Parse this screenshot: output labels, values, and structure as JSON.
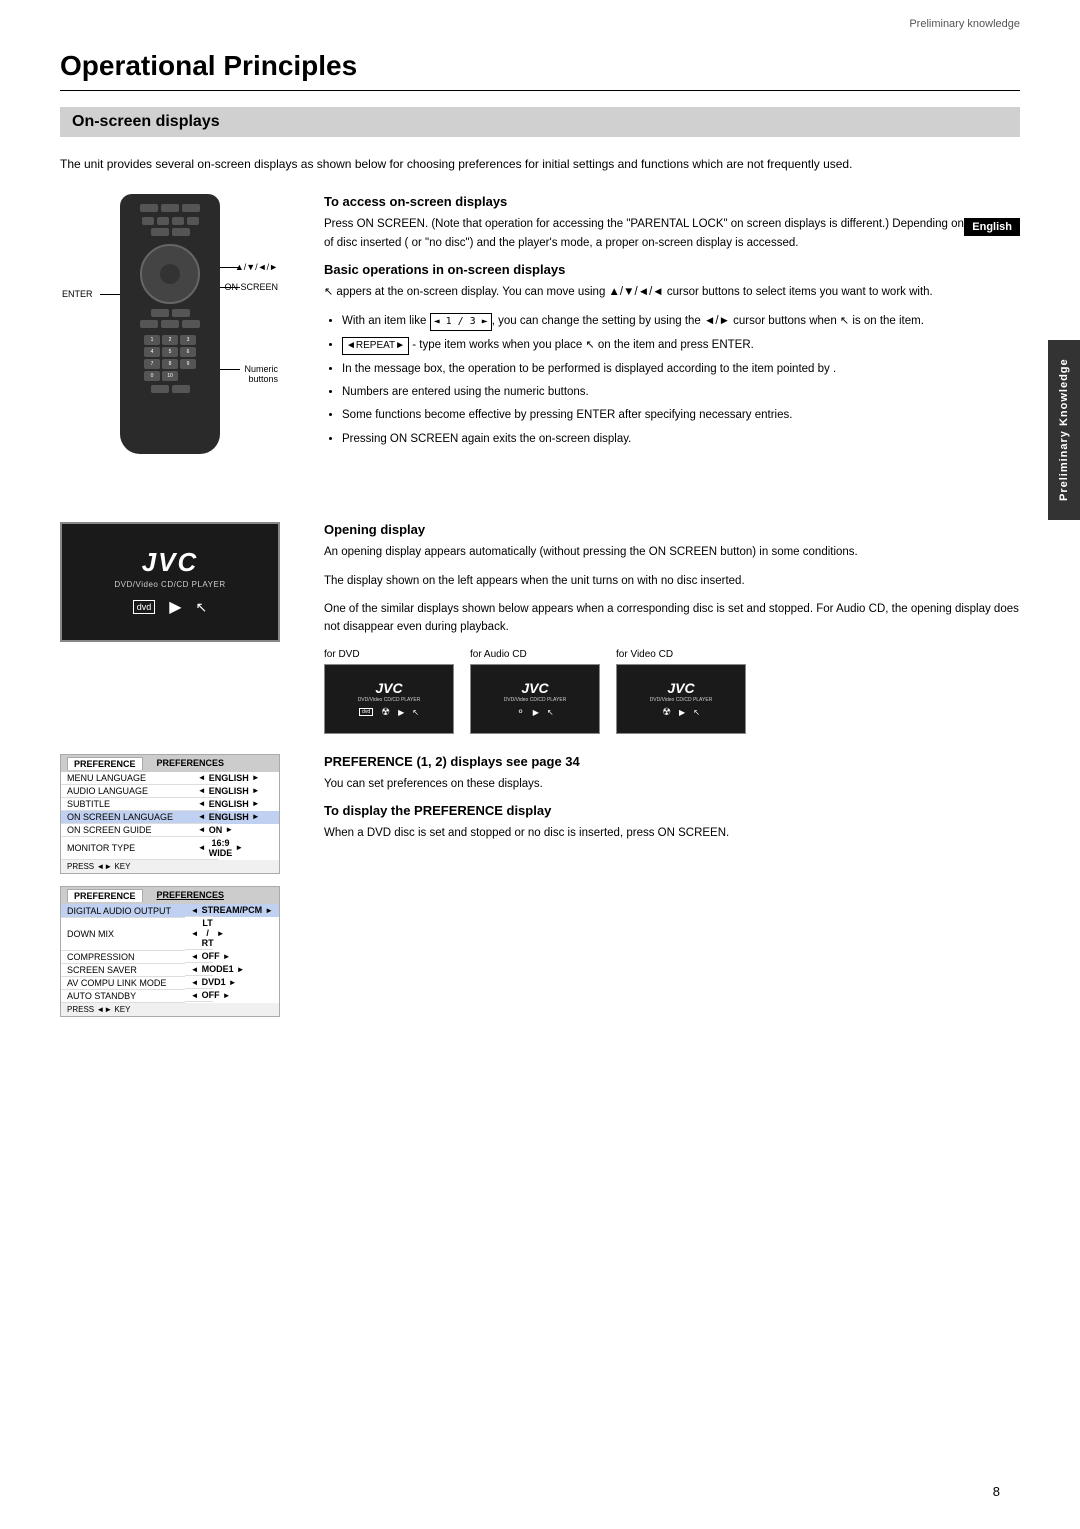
{
  "page": {
    "preliminary_knowledge": "Preliminary knowledge",
    "page_number": "8",
    "english_badge": "English",
    "side_tab": "Preliminary Knowledge"
  },
  "chapter": {
    "title": "Operational Principles"
  },
  "section": {
    "title": "On-screen displays"
  },
  "intro": {
    "text": "The unit provides several on-screen displays as shown below for choosing preferences for initial settings and functions which are not frequently used."
  },
  "access_section": {
    "heading": "To access on-screen displays",
    "body": "Press ON SCREEN. (Note that operation for accessing the \"PARENTAL LOCK\" on screen displays is different.) Depending on the type of disc inserted ( or \"no disc\") and the player's mode, a proper on-screen display is accessed."
  },
  "basic_ops": {
    "heading": "Basic operations in on-screen displays",
    "intro": "appers at the on-screen display. You can move  using ▲/▼/◄/◄ cursor buttons to select items you want to work with.",
    "bullet1": "With an item like  1 / 3 , you can change the setting by using the ◄/► cursor buttons when  is on the item.",
    "bullet2": "REPEAT  - type item works when you place  on the item and press ENTER.",
    "bullet3": "In the message box, the operation to be performed is displayed according to the item pointed by .",
    "bullet4": "Numbers are entered using the numeric buttons.",
    "bullet5": "Some functions become effective by pressing ENTER after specifying necessary entries.",
    "bullet6": "Pressing ON SCREEN again exits the on-screen display."
  },
  "opening_display": {
    "heading": "Opening display",
    "body1": "An opening display appears automatically (without pressing the ON SCREEN button) in some conditions.",
    "body2": "The display shown on the left appears when the unit turns on with no disc inserted.",
    "body3": "One of the similar displays shown below appears when a corresponding disc is set and stopped. For Audio CD, the opening display does not disappear even during playback.",
    "jvc_logo": "JVC",
    "jvc_subtitle": "DVD/Video CD/CD PLAYER",
    "for_dvd": "for DVD",
    "for_audio_cd": "for Audio CD",
    "for_video_cd": "for Video CD"
  },
  "preference_section": {
    "heading": "PREFERENCE (1, 2) displays see page 34",
    "body": "You can set preferences on these displays.",
    "display_heading": "To display the PREFERENCE display",
    "display_body": "When a DVD disc is set and stopped or no disc is inserted, press ON SCREEN."
  },
  "pref_table1": {
    "tab1": "PREFERENCE",
    "tab2": "PREFERENCES",
    "rows": [
      {
        "label": "MENU LANGUAGE",
        "value": "ENGLISH"
      },
      {
        "label": "AUDIO LANGUAGE",
        "value": "ENGLISH"
      },
      {
        "label": "SUBTITLE",
        "value": "ENGLISH"
      },
      {
        "label": "ON SCREEN LANGUAGE",
        "value": "ENGLISH"
      },
      {
        "label": "ON SCREEN GUIDE",
        "value": "ON"
      },
      {
        "label": "MONITOR TYPE",
        "value": "16:9 WIDE"
      }
    ],
    "footer": "PRESS ◄► KEY"
  },
  "pref_table2": {
    "tab1": "PREFERENCE",
    "tab2": "PREFERENCES",
    "rows": [
      {
        "label": "DIGITAL AUDIO OUTPUT",
        "value": "STREAM/PCM"
      },
      {
        "label": "DOWN MIX",
        "value": "LT / RT"
      },
      {
        "label": "COMPRESSION",
        "value": "OFF"
      },
      {
        "label": "SCREEN SAVER",
        "value": "MODE1"
      },
      {
        "label": "AV COMPU LINK MODE",
        "value": "DVD1"
      },
      {
        "label": "AUTO STANDBY",
        "value": "OFF"
      }
    ],
    "footer": "PRESS ◄► KEY"
  },
  "remote_labels": {
    "enter": "ENTER",
    "nav": "▲/▼/◄/►",
    "on_screen": "ON SCREEN",
    "numeric": "Numeric\nbuttons"
  }
}
